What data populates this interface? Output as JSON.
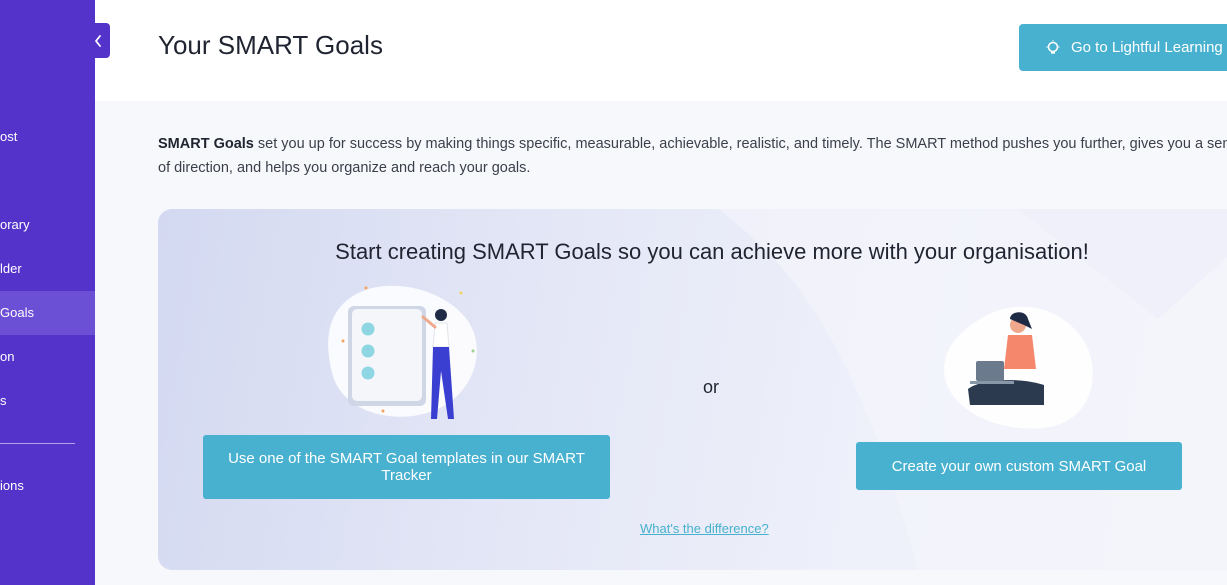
{
  "sidebar": {
    "items": [
      {
        "label": "ost",
        "active": false
      },
      {
        "label": "orary",
        "active": false
      },
      {
        "label": "lder",
        "active": false
      },
      {
        "label": "Goals",
        "active": true
      },
      {
        "label": "on",
        "active": false
      },
      {
        "label": "s",
        "active": false
      },
      {
        "label": "ions",
        "active": false
      }
    ],
    "collapse_icon": "chevron-left-icon"
  },
  "header": {
    "title": "Your SMART Goals",
    "learn_button": "Go to Lightful Learning",
    "learn_icon": "lightbulb-icon"
  },
  "intro": {
    "bold": "SMART Goals",
    "text": " set you up for success by making things specific, measurable, achievable, realistic, and timely. The SMART method pushes you further, gives you a sense of direction, and helps you organize and reach your goals."
  },
  "card": {
    "headline": "Start creating SMART Goals so you can achieve more with your organisation!",
    "or": "or",
    "template_button": "Use one of the SMART Goal templates in our SMART Tracker",
    "custom_button": "Create your own custom SMART Goal",
    "difference_link": "What's the difference?"
  },
  "colors": {
    "sidebar": "#5333c9",
    "sidebar_active": "#6b4fd4",
    "accent": "#47b1cf"
  }
}
